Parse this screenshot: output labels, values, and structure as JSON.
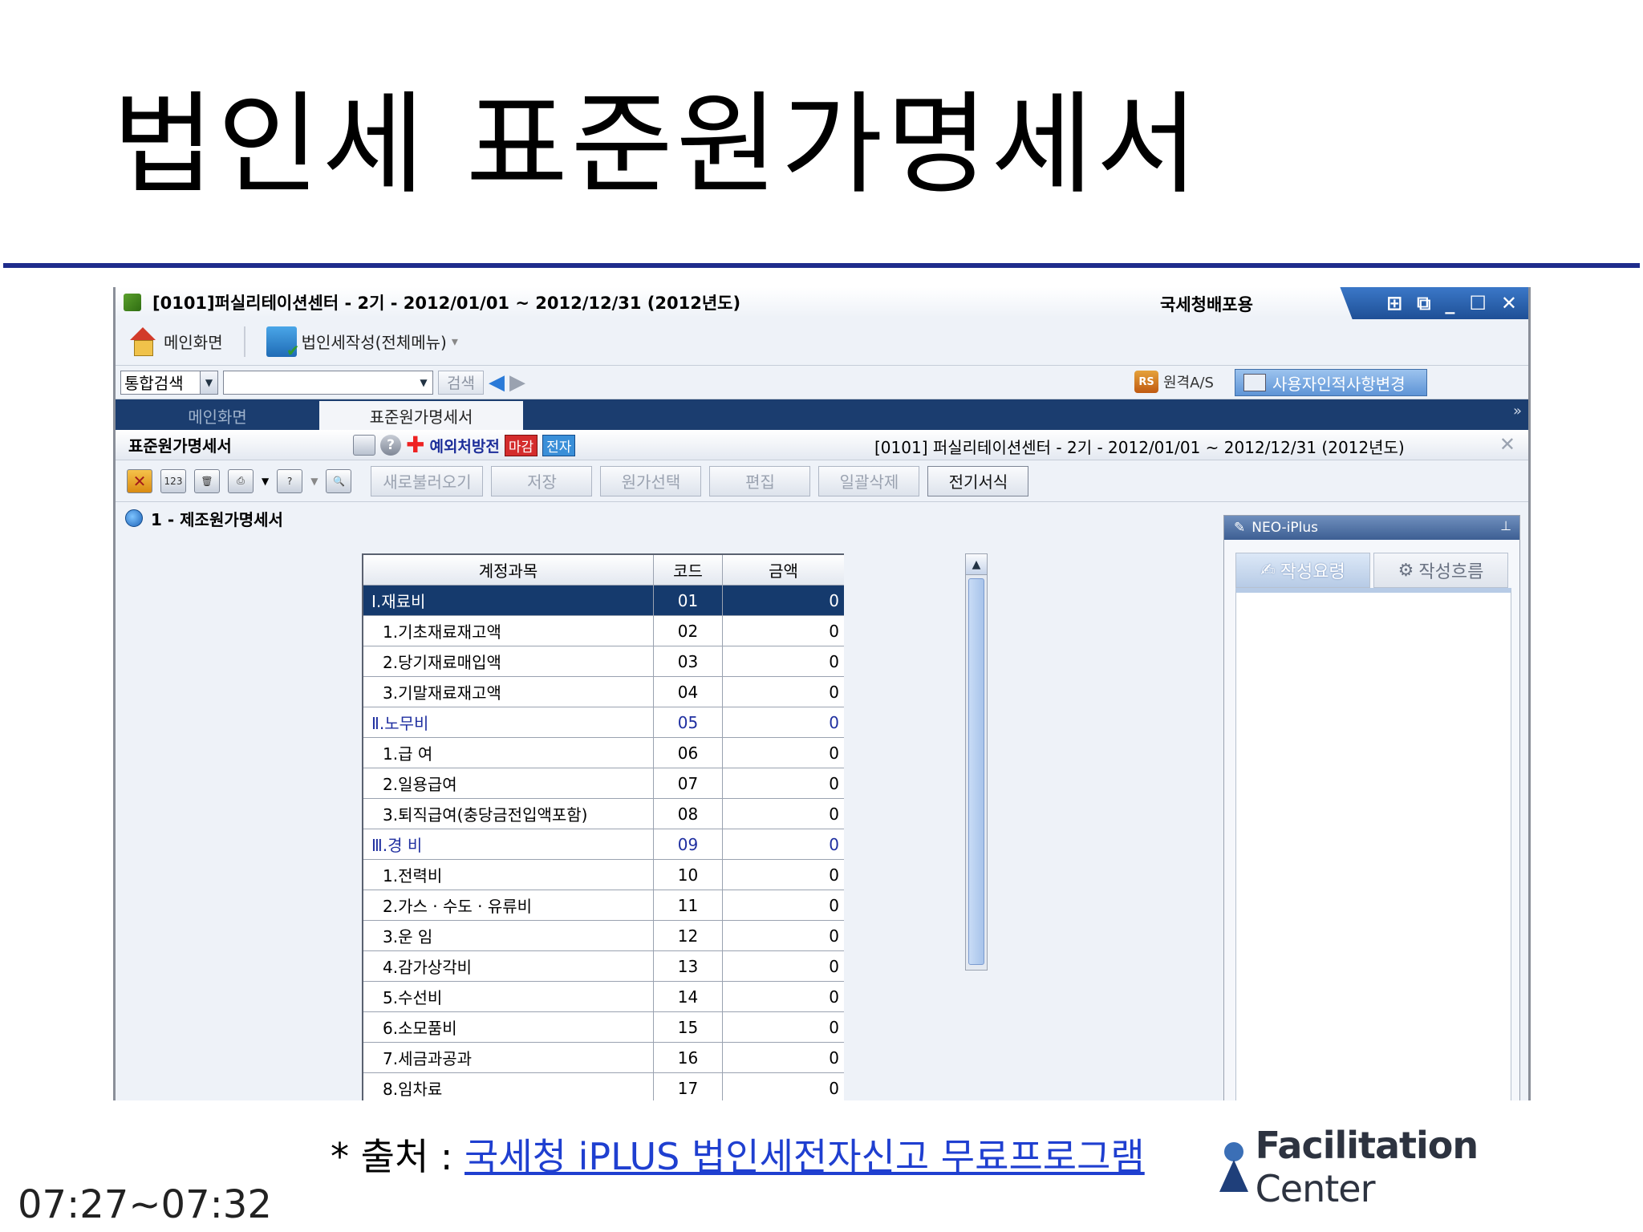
{
  "slide": {
    "title": "법인세 표준원가명세서",
    "source_prefix": "* 출처 : ",
    "source_link": "국세청 iPLUS 법인세전자신고 무료프로그램",
    "timecode": "07:27~07:32",
    "logo_bold": "Facilitation",
    "logo_light": " Center"
  },
  "app": {
    "window_title": "[0101]퍼실리테이션센터 - 2기 - 2012/01/01 ~ 2012/12/31 (2012년도)",
    "distribution": "국세청배포용",
    "window_controls": [
      "⊞",
      "⧉",
      "_",
      "☐",
      "✕"
    ],
    "menu": {
      "home": "메인화면",
      "corp_tax": "법인세작성(전체메뉴)",
      "dropdown_arrow": "▾"
    },
    "search": {
      "scope": "통합검색",
      "query": "",
      "button": "검색",
      "back": "◆",
      "forward": "◆",
      "remote_support": "원격A/S",
      "rs_badge": "RS",
      "user_info": "사용자인적사항변경"
    },
    "tabs": [
      "메인화면",
      "표준원가명세서"
    ],
    "tabs_more": "»",
    "form": {
      "title": "표준원가명세서",
      "help": "?",
      "exception": "예외처방전",
      "deadline_tag": "마감",
      "electronic_tag": "전자",
      "info": "[0101] 퍼실리테이션센터 - 2기 - 2012/01/01 ~ 2012/12/31 (2012년도)",
      "close": "✕"
    },
    "toolbar": {
      "calc_icon": "123",
      "buttons": [
        "새로불러오기",
        "저장",
        "원가선택",
        "편집",
        "일괄삭제",
        "전기서식"
      ]
    },
    "section_title": "1 - 제조원가명세서",
    "table": {
      "headers": [
        "계정과목",
        "코드",
        "금액"
      ],
      "rows": [
        {
          "account": "Ⅰ.재료비",
          "code": "01",
          "amount": "0",
          "type": "selected"
        },
        {
          "account": "1.기초재료재고액",
          "code": "02",
          "amount": "0",
          "type": "item"
        },
        {
          "account": "2.당기재료매입액",
          "code": "03",
          "amount": "0",
          "type": "item"
        },
        {
          "account": "3.기말재료재고액",
          "code": "04",
          "amount": "0",
          "type": "item"
        },
        {
          "account": "Ⅱ.노무비",
          "code": "05",
          "amount": "0",
          "type": "group"
        },
        {
          "account": "1.급      여",
          "code": "06",
          "amount": "0",
          "type": "item"
        },
        {
          "account": "2.일용급여",
          "code": "07",
          "amount": "0",
          "type": "item"
        },
        {
          "account": "3.퇴직급여(충당금전입액포함)",
          "code": "08",
          "amount": "0",
          "type": "item"
        },
        {
          "account": "Ⅲ.경   비",
          "code": "09",
          "amount": "0",
          "type": "group"
        },
        {
          "account": "1.전력비",
          "code": "10",
          "amount": "0",
          "type": "item"
        },
        {
          "account": "2.가스 · 수도 · 유류비",
          "code": "11",
          "amount": "0",
          "type": "item"
        },
        {
          "account": "3.운   임",
          "code": "12",
          "amount": "0",
          "type": "item"
        },
        {
          "account": "4.감가상각비",
          "code": "13",
          "amount": "0",
          "type": "item"
        },
        {
          "account": "5.수선비",
          "code": "14",
          "amount": "0",
          "type": "item"
        },
        {
          "account": "6.소모품비",
          "code": "15",
          "amount": "0",
          "type": "item"
        },
        {
          "account": "7.세금과공과",
          "code": "16",
          "amount": "0",
          "type": "item"
        },
        {
          "account": "8.임차료",
          "code": "17",
          "amount": "0",
          "type": "item"
        }
      ]
    },
    "neo_panel": {
      "title": "NEO-iPlus",
      "pin": "ꟷ",
      "tabs": [
        "작성요령",
        "작성흐름"
      ]
    }
  }
}
